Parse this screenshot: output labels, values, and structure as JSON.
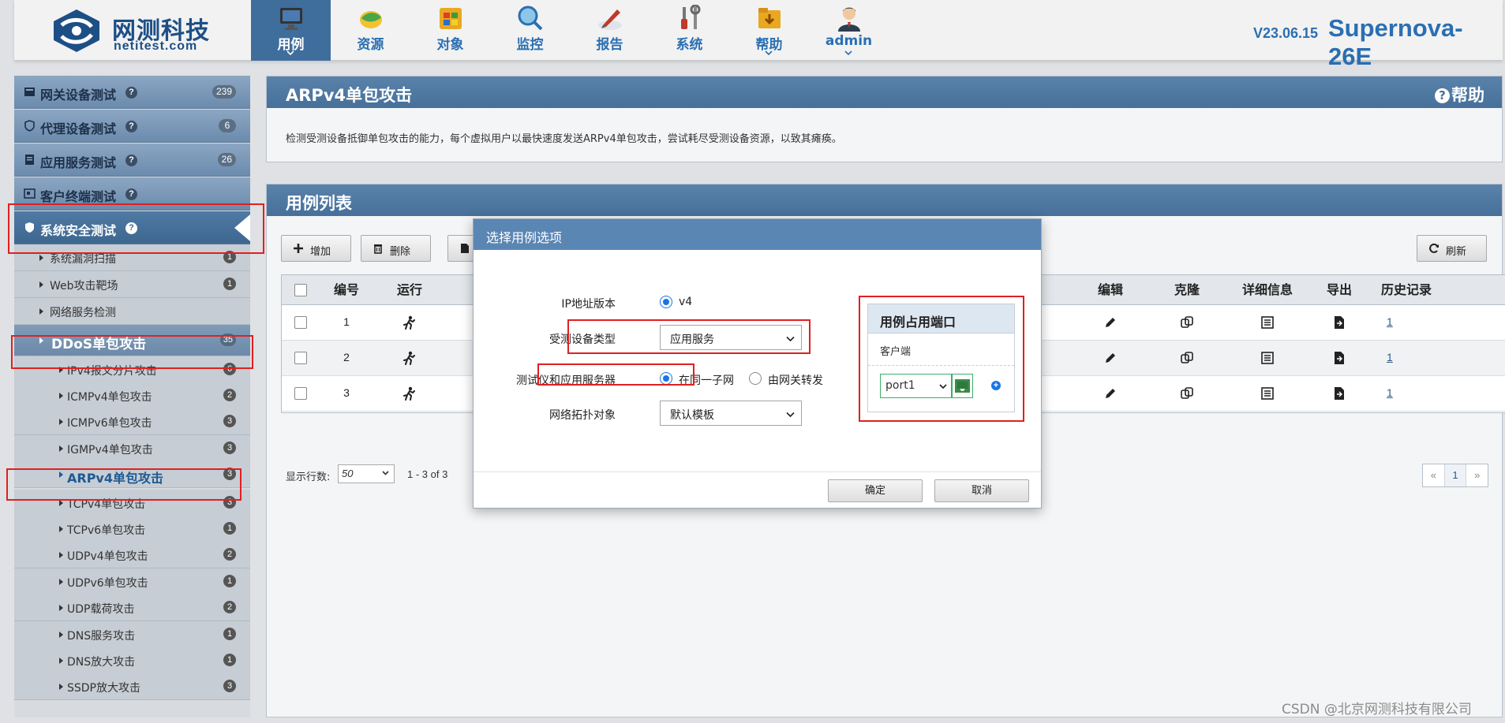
{
  "header": {
    "logo_cn": "网测科技",
    "logo_en": "netitest.com",
    "version": "V23.06.15",
    "product": "Supernova-26E",
    "nav": [
      {
        "label": "用例",
        "icon": "monitor-icon",
        "active": true,
        "caret": true
      },
      {
        "label": "资源",
        "icon": "globe-leaf-icon",
        "active": false,
        "caret": false
      },
      {
        "label": "对象",
        "icon": "windows-cube-icon",
        "active": false,
        "caret": false
      },
      {
        "label": "监控",
        "icon": "magnifier-globe-icon",
        "active": false,
        "caret": false
      },
      {
        "label": "报告",
        "icon": "pen-report-icon",
        "active": false,
        "caret": false
      },
      {
        "label": "系统",
        "icon": "tools-icon",
        "active": false,
        "caret": false
      },
      {
        "label": "帮助",
        "icon": "folder-help-icon",
        "active": false,
        "caret": true
      },
      {
        "label": "admin",
        "icon": "user-avatar-icon",
        "active": false,
        "caret": true
      }
    ]
  },
  "sidebar": {
    "categories": [
      {
        "label": "网关设备测试",
        "badge": "239",
        "icon": "server-icon"
      },
      {
        "label": "代理设备测试",
        "badge": "6",
        "icon": "shield-icon"
      },
      {
        "label": "应用服务测试",
        "badge": "26",
        "icon": "document-icon"
      },
      {
        "label": "客户终端测试",
        "badge": "",
        "icon": "terminal-icon"
      },
      {
        "label": "系统安全测试",
        "badge": "",
        "icon": "security-shield-icon"
      }
    ],
    "subitems": [
      {
        "label": "系统漏洞扫描",
        "badge": "1"
      },
      {
        "label": "Web攻击靶场",
        "badge": "1"
      },
      {
        "label": "网络服务检测",
        "badge": ""
      }
    ],
    "group": {
      "label": "DDoS单包攻击",
      "badge": "35"
    },
    "leaves": [
      {
        "label": "IPv4报文分片攻击",
        "badge": "6"
      },
      {
        "label": "ICMPv4单包攻击",
        "badge": "2"
      },
      {
        "label": "ICMPv6单包攻击",
        "badge": "3"
      },
      {
        "label": "IGMPv4单包攻击",
        "badge": "3"
      },
      {
        "label": "ARPv4单包攻击",
        "badge": "3"
      },
      {
        "label": "TCPv4单包攻击",
        "badge": "3"
      },
      {
        "label": "TCPv6单包攻击",
        "badge": "1"
      },
      {
        "label": "UDPv4单包攻击",
        "badge": "2"
      },
      {
        "label": "UDPv6单包攻击",
        "badge": "1"
      },
      {
        "label": "UDP载荷攻击",
        "badge": "2"
      },
      {
        "label": "DNS服务攻击",
        "badge": "1"
      },
      {
        "label": "DNS放大攻击",
        "badge": "1"
      },
      {
        "label": "SSDP放大攻击",
        "badge": "3"
      }
    ]
  },
  "info_panel": {
    "title": "ARPv4单包攻击",
    "help": "帮助",
    "description": "检测受测设备抵御单包攻击的能力，每个虚拟用户以最快速度发送ARPv4单包攻击，尝试耗尽受测设备资源，以致其瘫痪。"
  },
  "list_panel": {
    "title": "用例列表",
    "add": "增加",
    "delete": "删除",
    "refresh": "刷新",
    "columns": {
      "num": "编号",
      "run": "运行",
      "edit": "编辑",
      "clone": "克隆",
      "detail": "详细信息",
      "export": "导出",
      "history": "历史记录"
    },
    "rows": [
      {
        "num": "1",
        "history": "1"
      },
      {
        "num": "2",
        "history": "1"
      },
      {
        "num": "3",
        "history": "1"
      }
    ],
    "rows_label": "显示行数:",
    "rows_value": "50",
    "range": "1 - 3 of 3",
    "pager": {
      "prev": "«",
      "page": "1",
      "next": "»"
    }
  },
  "modal": {
    "title": "选择用例选项",
    "ip_label": "IP地址版本",
    "ip_value": "v4",
    "dut_label": "受测设备类型",
    "dut_value": "应用服务",
    "net_label": "测试仪和应用服务器",
    "net_opt1": "在同一子网",
    "net_opt2": "由网关转发",
    "topo_label": "网络拓扑对象",
    "topo_value": "默认模板",
    "port_title": "用例占用端口",
    "port_client": "客户端",
    "port_value": "port1",
    "ok": "确定",
    "cancel": "取消"
  },
  "watermark": "CSDN @北京网测科技有限公司"
}
